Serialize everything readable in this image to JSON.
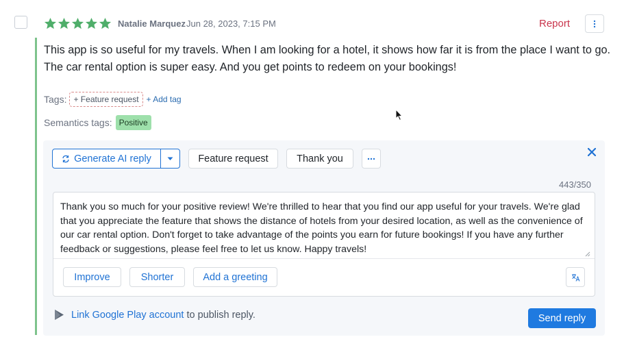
{
  "review": {
    "rating": 5,
    "max_rating": 5,
    "author": "Natalie Marquez",
    "date": "Jun 28, 2023, 7:15 PM",
    "report_label": "Report",
    "text": "This app is so useful for my travels. When I am looking for a hotel, it shows how far it is from the place I want to go. The car rental option is super easy. And you get points to redeem on your bookings!"
  },
  "tags": {
    "label": "Tags:",
    "items": [
      "+ Feature request"
    ],
    "add_label": "+ Add tag"
  },
  "semantics": {
    "label": "Semantics tags:",
    "badge": "Positive"
  },
  "reply_panel": {
    "generate_label": "Generate AI reply",
    "templates": [
      "Feature request",
      "Thank you"
    ],
    "char_counter": "443/350",
    "reply_text": "Thank you so much for your positive review! We're thrilled to hear that you find our app useful for your travels. We're glad that you appreciate the feature that shows the distance of hotels from your desired location, as well as the convenience of our car rental option. Don't forget to take advantage of the points you earn for future bookings! If you have any further feedback or suggestions, please feel free to let us know. Happy travels!",
    "actions": [
      "Improve",
      "Shorter",
      "Add a greeting"
    ],
    "link_text": "Link Google Play account",
    "link_suffix": " to publish reply.",
    "send_label": "Send reply"
  },
  "colors": {
    "star": "#4fae6a",
    "accent": "#1f72d4",
    "report": "#c9344b",
    "positive_badge": "#9ee0ab",
    "rail": "#7ec38c"
  },
  "icons": {
    "rating": "star-icon",
    "menu": "vertical-ellipsis-icon",
    "generate": "refresh-sparkle-icon",
    "caret": "chevron-down-icon",
    "more": "horizontal-ellipsis-icon",
    "close": "close-icon",
    "translate": "translate-icon",
    "store": "google-play-icon"
  }
}
